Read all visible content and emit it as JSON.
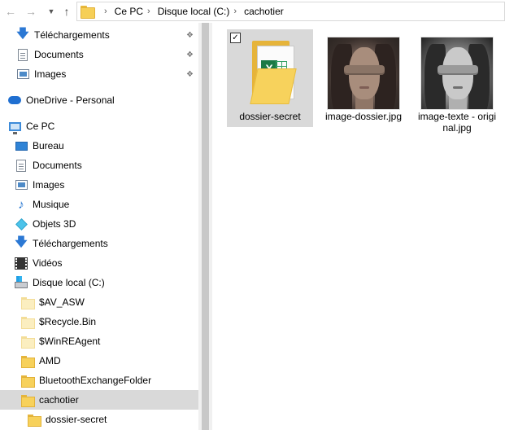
{
  "address": {
    "crumbs": [
      "Ce PC",
      "Disque local (C:)",
      "cachotier"
    ],
    "separator": "›"
  },
  "nav": {
    "items": [
      {
        "label": "Téléchargements",
        "icon": "download-arrow-icon",
        "pinned": true
      },
      {
        "label": "Documents",
        "icon": "documents-icon",
        "pinned": true
      },
      {
        "label": "Images",
        "icon": "pictures-icon",
        "pinned": true
      },
      {
        "label": "OneDrive - Personal",
        "icon": "onedrive-cloud-icon"
      },
      {
        "label": "Ce PC",
        "icon": "this-pc-icon"
      },
      {
        "label": "Bureau",
        "icon": "desktop-icon"
      },
      {
        "label": "Documents",
        "icon": "documents-icon"
      },
      {
        "label": "Images",
        "icon": "pictures-icon"
      },
      {
        "label": "Musique",
        "icon": "music-icon"
      },
      {
        "label": "Objets 3D",
        "icon": "3d-objects-icon"
      },
      {
        "label": "Téléchargements",
        "icon": "download-arrow-icon"
      },
      {
        "label": "Vidéos",
        "icon": "videos-icon"
      },
      {
        "label": "Disque local (C:)",
        "icon": "local-disk-icon"
      },
      {
        "label": "$AV_ASW",
        "icon": "hidden-folder-icon"
      },
      {
        "label": "$Recycle.Bin",
        "icon": "hidden-folder-icon"
      },
      {
        "label": "$WinREAgent",
        "icon": "hidden-folder-icon"
      },
      {
        "label": "AMD",
        "icon": "folder-icon"
      },
      {
        "label": "BluetoothExchangeFolder",
        "icon": "folder-icon"
      },
      {
        "label": "cachotier",
        "icon": "folder-icon",
        "selected": true
      },
      {
        "label": "dossier-secret",
        "icon": "folder-icon"
      }
    ]
  },
  "files": [
    {
      "name": "dossier-secret",
      "type": "folder",
      "selected": true,
      "checked": "✓"
    },
    {
      "name": "image-dossier.jpg",
      "type": "image"
    },
    {
      "name": "image-texte - original.jpg",
      "type": "image"
    }
  ],
  "colors": {
    "selection": "#d9d9d9",
    "accent": "#2b78d4",
    "folder": "#f7d15b"
  }
}
